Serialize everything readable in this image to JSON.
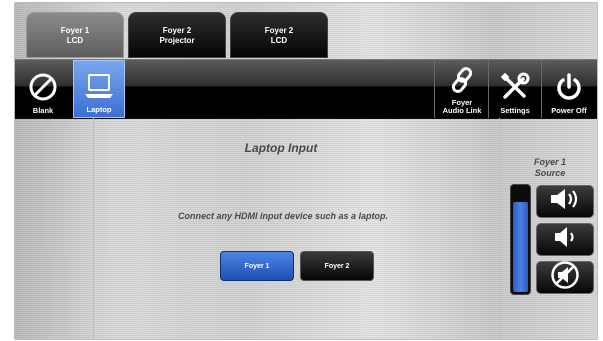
{
  "tabs": [
    {
      "label": "Foyer 1\nLCD",
      "active": true
    },
    {
      "label": "Foyer 2\nProjector",
      "active": false
    },
    {
      "label": "Foyer 2\nLCD",
      "active": false
    }
  ],
  "toolbar": {
    "blank_label": "Blank",
    "laptop_label": "Laptop",
    "audio_link_label": "Foyer\nAudio Link",
    "settings_label": "Settings",
    "power_off_label": "Power Off",
    "selected": "Laptop"
  },
  "main": {
    "title": "Laptop Input",
    "message": "Connect any HDMI input device such as a laptop.",
    "sources": [
      {
        "label": "Foyer 1",
        "selected": true
      },
      {
        "label": "Foyer 2",
        "selected": false
      }
    ]
  },
  "volume": {
    "title": "Foyer 1\nSource",
    "level": 0.86,
    "buttons": [
      "volume-up-icon",
      "volume-down-icon",
      "mute-icon"
    ]
  },
  "colors": {
    "accent": "#3b6fd2",
    "toolbar": "#000000",
    "text": "#4a4a4a"
  }
}
